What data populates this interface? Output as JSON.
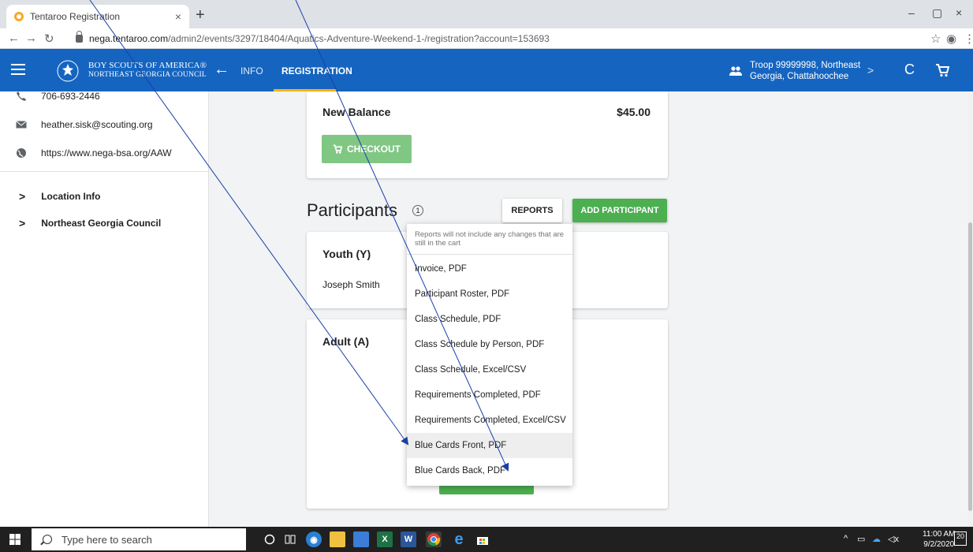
{
  "browser": {
    "tab_title": "Tentaroo Registration",
    "tab_close": "×",
    "new_tab": "+",
    "url_host": "nega.tentaroo.com",
    "url_path": "/admin2/events/3297/18404/Aquatics-Adventure-Weekend-1-/registration?account=153693",
    "minimize": "–",
    "maximize": "▢",
    "close": "×"
  },
  "appbar": {
    "org_line1": "BOY SCOUTS OF AMERICA®",
    "org_line2": "NORTHEAST GEORGIA COUNCIL",
    "tab_info": "INFO",
    "tab_registration": "REGISTRATION",
    "troop_line1": "Troop 99999998, Northeast",
    "troop_line2": "Georgia, Chattahoochee"
  },
  "sidebar": {
    "phone": "706-693-2446",
    "email": "heather.sisk@scouting.org",
    "website": "https://www.nega-bsa.org/AAW",
    "sections": [
      {
        "label": "Location Info"
      },
      {
        "label": "Northeast Georgia Council"
      }
    ]
  },
  "balance": {
    "label": "New Balance",
    "value": "$45.00",
    "checkout_label": "CHECKOUT"
  },
  "participants": {
    "title": "Participants",
    "count": "1",
    "reports_label": "REPORTS",
    "add_label": "ADD PARTICIPANT",
    "youth_title": "Youth (Y)",
    "youth_name": "Joseph Smith",
    "adult_title": "Adult (A)"
  },
  "reports_menu": {
    "note": "Reports will not include any changes that are still in the cart",
    "items": [
      {
        "label": "Invoice, PDF"
      },
      {
        "label": "Participant Roster, PDF"
      },
      {
        "label": "Class Schedule, PDF"
      },
      {
        "label": "Class Schedule by Person, PDF"
      },
      {
        "label": "Class Schedule, Excel/CSV"
      },
      {
        "label": "Requirements Completed, PDF"
      },
      {
        "label": "Requirements Completed, Excel/CSV"
      },
      {
        "label": "Blue Cards Front, PDF"
      },
      {
        "label": "Blue Cards Back, PDF"
      }
    ],
    "highlighted_item": "Blue Cards Front, PDF"
  },
  "taskbar": {
    "search_placeholder": "Type here to search",
    "time": "11:00 AM",
    "date": "9/2/2020",
    "notifications": "20"
  },
  "colors": {
    "appbar": "#1565c0",
    "tab_underline": "#ffb300",
    "add_button": "#4caf50",
    "checkout_disabled": "#81c784",
    "arrow": "#1a3fa8"
  }
}
